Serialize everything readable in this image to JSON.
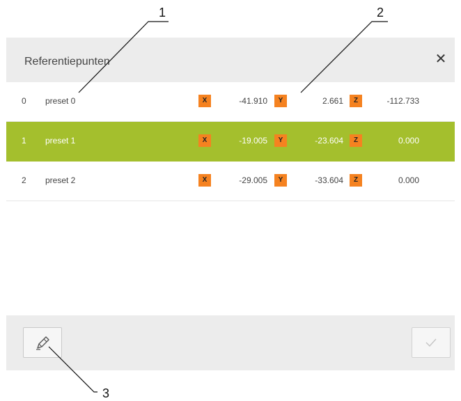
{
  "dialog": {
    "title": "Referentiepunten",
    "close_icon": "close-icon",
    "presets": [
      {
        "index": "0",
        "name": "preset 0",
        "x": "-41.910",
        "y": "2.661",
        "z": "-112.733",
        "selected": false
      },
      {
        "index": "1",
        "name": "preset 1",
        "x": "-19.005",
        "y": "-23.604",
        "z": "0.000",
        "selected": true
      },
      {
        "index": "2",
        "name": "preset 2",
        "x": "-29.005",
        "y": "-33.604",
        "z": "0.000",
        "selected": false
      }
    ],
    "axis_labels": {
      "x": "X",
      "y": "Y",
      "z": "Z"
    },
    "footer": {
      "edit_icon": "pencil-icon",
      "confirm_icon": "checkmark-icon"
    }
  },
  "callouts": [
    "1",
    "2",
    "3"
  ],
  "colors": {
    "selected_row": "#a4bf2d",
    "axis_badge": "#f58220",
    "header_bg": "#ececec"
  }
}
